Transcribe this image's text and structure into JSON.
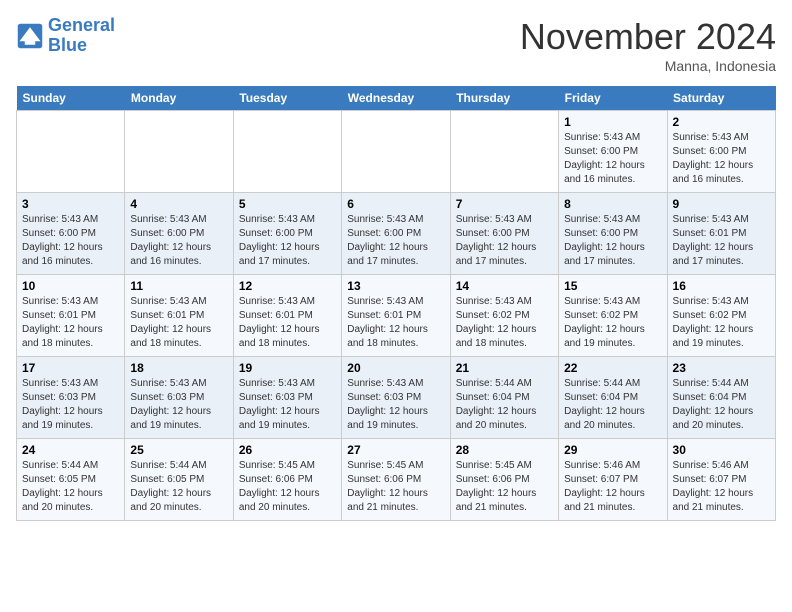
{
  "header": {
    "logo_line1": "General",
    "logo_line2": "Blue",
    "month": "November 2024",
    "location": "Manna, Indonesia"
  },
  "days_of_week": [
    "Sunday",
    "Monday",
    "Tuesday",
    "Wednesday",
    "Thursday",
    "Friday",
    "Saturday"
  ],
  "weeks": [
    [
      {
        "day": "",
        "info": ""
      },
      {
        "day": "",
        "info": ""
      },
      {
        "day": "",
        "info": ""
      },
      {
        "day": "",
        "info": ""
      },
      {
        "day": "",
        "info": ""
      },
      {
        "day": "1",
        "info": "Sunrise: 5:43 AM\nSunset: 6:00 PM\nDaylight: 12 hours\nand 16 minutes."
      },
      {
        "day": "2",
        "info": "Sunrise: 5:43 AM\nSunset: 6:00 PM\nDaylight: 12 hours\nand 16 minutes."
      }
    ],
    [
      {
        "day": "3",
        "info": "Sunrise: 5:43 AM\nSunset: 6:00 PM\nDaylight: 12 hours\nand 16 minutes."
      },
      {
        "day": "4",
        "info": "Sunrise: 5:43 AM\nSunset: 6:00 PM\nDaylight: 12 hours\nand 16 minutes."
      },
      {
        "day": "5",
        "info": "Sunrise: 5:43 AM\nSunset: 6:00 PM\nDaylight: 12 hours\nand 17 minutes."
      },
      {
        "day": "6",
        "info": "Sunrise: 5:43 AM\nSunset: 6:00 PM\nDaylight: 12 hours\nand 17 minutes."
      },
      {
        "day": "7",
        "info": "Sunrise: 5:43 AM\nSunset: 6:00 PM\nDaylight: 12 hours\nand 17 minutes."
      },
      {
        "day": "8",
        "info": "Sunrise: 5:43 AM\nSunset: 6:00 PM\nDaylight: 12 hours\nand 17 minutes."
      },
      {
        "day": "9",
        "info": "Sunrise: 5:43 AM\nSunset: 6:01 PM\nDaylight: 12 hours\nand 17 minutes."
      }
    ],
    [
      {
        "day": "10",
        "info": "Sunrise: 5:43 AM\nSunset: 6:01 PM\nDaylight: 12 hours\nand 18 minutes."
      },
      {
        "day": "11",
        "info": "Sunrise: 5:43 AM\nSunset: 6:01 PM\nDaylight: 12 hours\nand 18 minutes."
      },
      {
        "day": "12",
        "info": "Sunrise: 5:43 AM\nSunset: 6:01 PM\nDaylight: 12 hours\nand 18 minutes."
      },
      {
        "day": "13",
        "info": "Sunrise: 5:43 AM\nSunset: 6:01 PM\nDaylight: 12 hours\nand 18 minutes."
      },
      {
        "day": "14",
        "info": "Sunrise: 5:43 AM\nSunset: 6:02 PM\nDaylight: 12 hours\nand 18 minutes."
      },
      {
        "day": "15",
        "info": "Sunrise: 5:43 AM\nSunset: 6:02 PM\nDaylight: 12 hours\nand 19 minutes."
      },
      {
        "day": "16",
        "info": "Sunrise: 5:43 AM\nSunset: 6:02 PM\nDaylight: 12 hours\nand 19 minutes."
      }
    ],
    [
      {
        "day": "17",
        "info": "Sunrise: 5:43 AM\nSunset: 6:03 PM\nDaylight: 12 hours\nand 19 minutes."
      },
      {
        "day": "18",
        "info": "Sunrise: 5:43 AM\nSunset: 6:03 PM\nDaylight: 12 hours\nand 19 minutes."
      },
      {
        "day": "19",
        "info": "Sunrise: 5:43 AM\nSunset: 6:03 PM\nDaylight: 12 hours\nand 19 minutes."
      },
      {
        "day": "20",
        "info": "Sunrise: 5:43 AM\nSunset: 6:03 PM\nDaylight: 12 hours\nand 19 minutes."
      },
      {
        "day": "21",
        "info": "Sunrise: 5:44 AM\nSunset: 6:04 PM\nDaylight: 12 hours\nand 20 minutes."
      },
      {
        "day": "22",
        "info": "Sunrise: 5:44 AM\nSunset: 6:04 PM\nDaylight: 12 hours\nand 20 minutes."
      },
      {
        "day": "23",
        "info": "Sunrise: 5:44 AM\nSunset: 6:04 PM\nDaylight: 12 hours\nand 20 minutes."
      }
    ],
    [
      {
        "day": "24",
        "info": "Sunrise: 5:44 AM\nSunset: 6:05 PM\nDaylight: 12 hours\nand 20 minutes."
      },
      {
        "day": "25",
        "info": "Sunrise: 5:44 AM\nSunset: 6:05 PM\nDaylight: 12 hours\nand 20 minutes."
      },
      {
        "day": "26",
        "info": "Sunrise: 5:45 AM\nSunset: 6:06 PM\nDaylight: 12 hours\nand 20 minutes."
      },
      {
        "day": "27",
        "info": "Sunrise: 5:45 AM\nSunset: 6:06 PM\nDaylight: 12 hours\nand 21 minutes."
      },
      {
        "day": "28",
        "info": "Sunrise: 5:45 AM\nSunset: 6:06 PM\nDaylight: 12 hours\nand 21 minutes."
      },
      {
        "day": "29",
        "info": "Sunrise: 5:46 AM\nSunset: 6:07 PM\nDaylight: 12 hours\nand 21 minutes."
      },
      {
        "day": "30",
        "info": "Sunrise: 5:46 AM\nSunset: 6:07 PM\nDaylight: 12 hours\nand 21 minutes."
      }
    ]
  ]
}
